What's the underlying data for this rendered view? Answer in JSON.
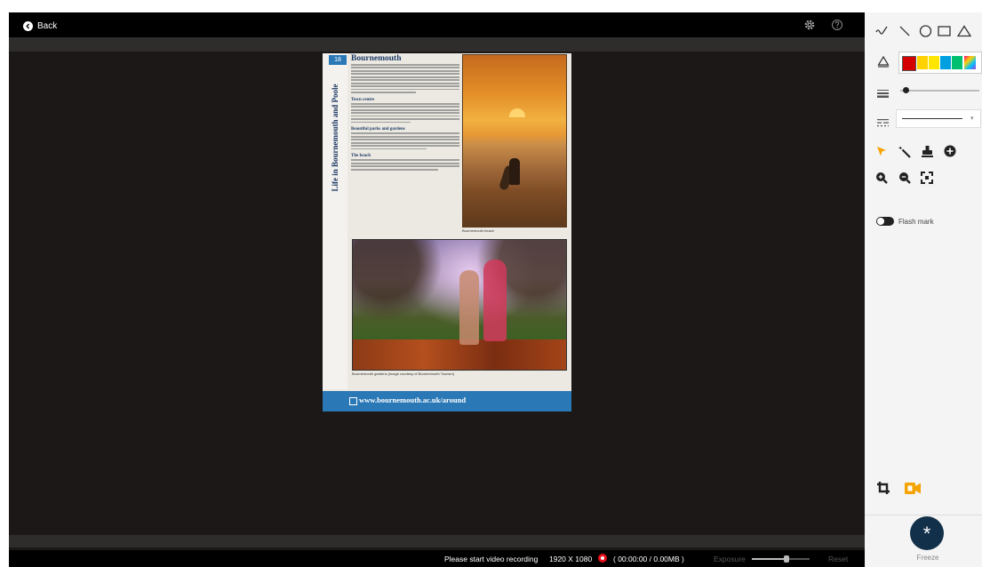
{
  "viewer": {
    "back_label": "Back",
    "document": {
      "page_number": "18",
      "spine_title": "Life in Bournemouth and Poole",
      "heading": "Bournemouth",
      "subheadings": [
        "Town centre",
        "Beautiful parks and gardens",
        "The beach"
      ],
      "caption_sunset": "Bournemouth beach",
      "caption_park": "Bournemouth gardens (image courtesy of Bournemouth Tourism)",
      "footer_url": "www.bournemouth.ac.uk/around"
    }
  },
  "status_bar": {
    "message": "Please start video recording",
    "resolution": "1920 X 1080",
    "timer": "( 00:00:00 / 0.00MB )",
    "exposure_label": "Exposure",
    "exposure_level": 0.6,
    "reset_label": "Reset"
  },
  "toolbar": {
    "shape_tools": [
      "freehand-icon",
      "line-icon",
      "circle-icon",
      "rectangle-icon",
      "triangle-icon"
    ],
    "colors": [
      "#d40000",
      "#ffd200",
      "#ffe600",
      "#00a0e0",
      "#00c070",
      "#a040e0"
    ],
    "selected_color": "#d40000",
    "line_width_level": 0.05,
    "action_tools": [
      "pointer-icon",
      "magic-wand-icon",
      "stamp-icon",
      "add-icon",
      "zoom-in-icon",
      "zoom-out-icon",
      "fit-screen-icon"
    ],
    "flash_mark_label": "Flash mark",
    "flash_mark_on": false,
    "freeze_label": "Freeze"
  }
}
